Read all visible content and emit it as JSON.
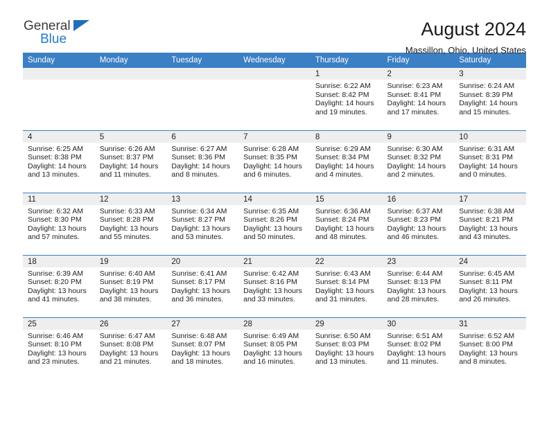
{
  "brand": {
    "name_part1": "General",
    "name_part2": "Blue",
    "triangle_color": "#1f6fb8",
    "blue_color": "#2079c7"
  },
  "header": {
    "title": "August 2024",
    "subtitle": "Massillon, Ohio, United States"
  },
  "theme": {
    "header_blue": "#3b7fc4",
    "daynum_gray": "#eeeeee"
  },
  "calendar": {
    "weekday_headers": [
      "Sunday",
      "Monday",
      "Tuesday",
      "Wednesday",
      "Thursday",
      "Friday",
      "Saturday"
    ],
    "labels": {
      "sunrise": "Sunrise:",
      "sunset": "Sunset:",
      "daylight": "Daylight:"
    },
    "weeks": [
      [
        {
          "day": "",
          "empty": true
        },
        {
          "day": "",
          "empty": true
        },
        {
          "day": "",
          "empty": true
        },
        {
          "day": "",
          "empty": true
        },
        {
          "day": "1",
          "sunrise": "Sunrise: 6:22 AM",
          "sunset": "Sunset: 8:42 PM",
          "daylight": "Daylight: 14 hours and 19 minutes."
        },
        {
          "day": "2",
          "sunrise": "Sunrise: 6:23 AM",
          "sunset": "Sunset: 8:41 PM",
          "daylight": "Daylight: 14 hours and 17 minutes."
        },
        {
          "day": "3",
          "sunrise": "Sunrise: 6:24 AM",
          "sunset": "Sunset: 8:39 PM",
          "daylight": "Daylight: 14 hours and 15 minutes."
        }
      ],
      [
        {
          "day": "4",
          "sunrise": "Sunrise: 6:25 AM",
          "sunset": "Sunset: 8:38 PM",
          "daylight": "Daylight: 14 hours and 13 minutes."
        },
        {
          "day": "5",
          "sunrise": "Sunrise: 6:26 AM",
          "sunset": "Sunset: 8:37 PM",
          "daylight": "Daylight: 14 hours and 11 minutes."
        },
        {
          "day": "6",
          "sunrise": "Sunrise: 6:27 AM",
          "sunset": "Sunset: 8:36 PM",
          "daylight": "Daylight: 14 hours and 8 minutes."
        },
        {
          "day": "7",
          "sunrise": "Sunrise: 6:28 AM",
          "sunset": "Sunset: 8:35 PM",
          "daylight": "Daylight: 14 hours and 6 minutes."
        },
        {
          "day": "8",
          "sunrise": "Sunrise: 6:29 AM",
          "sunset": "Sunset: 8:34 PM",
          "daylight": "Daylight: 14 hours and 4 minutes."
        },
        {
          "day": "9",
          "sunrise": "Sunrise: 6:30 AM",
          "sunset": "Sunset: 8:32 PM",
          "daylight": "Daylight: 14 hours and 2 minutes."
        },
        {
          "day": "10",
          "sunrise": "Sunrise: 6:31 AM",
          "sunset": "Sunset: 8:31 PM",
          "daylight": "Daylight: 14 hours and 0 minutes."
        }
      ],
      [
        {
          "day": "11",
          "sunrise": "Sunrise: 6:32 AM",
          "sunset": "Sunset: 8:30 PM",
          "daylight": "Daylight: 13 hours and 57 minutes."
        },
        {
          "day": "12",
          "sunrise": "Sunrise: 6:33 AM",
          "sunset": "Sunset: 8:28 PM",
          "daylight": "Daylight: 13 hours and 55 minutes."
        },
        {
          "day": "13",
          "sunrise": "Sunrise: 6:34 AM",
          "sunset": "Sunset: 8:27 PM",
          "daylight": "Daylight: 13 hours and 53 minutes."
        },
        {
          "day": "14",
          "sunrise": "Sunrise: 6:35 AM",
          "sunset": "Sunset: 8:26 PM",
          "daylight": "Daylight: 13 hours and 50 minutes."
        },
        {
          "day": "15",
          "sunrise": "Sunrise: 6:36 AM",
          "sunset": "Sunset: 8:24 PM",
          "daylight": "Daylight: 13 hours and 48 minutes."
        },
        {
          "day": "16",
          "sunrise": "Sunrise: 6:37 AM",
          "sunset": "Sunset: 8:23 PM",
          "daylight": "Daylight: 13 hours and 46 minutes."
        },
        {
          "day": "17",
          "sunrise": "Sunrise: 6:38 AM",
          "sunset": "Sunset: 8:21 PM",
          "daylight": "Daylight: 13 hours and 43 minutes."
        }
      ],
      [
        {
          "day": "18",
          "sunrise": "Sunrise: 6:39 AM",
          "sunset": "Sunset: 8:20 PM",
          "daylight": "Daylight: 13 hours and 41 minutes."
        },
        {
          "day": "19",
          "sunrise": "Sunrise: 6:40 AM",
          "sunset": "Sunset: 8:19 PM",
          "daylight": "Daylight: 13 hours and 38 minutes."
        },
        {
          "day": "20",
          "sunrise": "Sunrise: 6:41 AM",
          "sunset": "Sunset: 8:17 PM",
          "daylight": "Daylight: 13 hours and 36 minutes."
        },
        {
          "day": "21",
          "sunrise": "Sunrise: 6:42 AM",
          "sunset": "Sunset: 8:16 PM",
          "daylight": "Daylight: 13 hours and 33 minutes."
        },
        {
          "day": "22",
          "sunrise": "Sunrise: 6:43 AM",
          "sunset": "Sunset: 8:14 PM",
          "daylight": "Daylight: 13 hours and 31 minutes."
        },
        {
          "day": "23",
          "sunrise": "Sunrise: 6:44 AM",
          "sunset": "Sunset: 8:13 PM",
          "daylight": "Daylight: 13 hours and 28 minutes."
        },
        {
          "day": "24",
          "sunrise": "Sunrise: 6:45 AM",
          "sunset": "Sunset: 8:11 PM",
          "daylight": "Daylight: 13 hours and 26 minutes."
        }
      ],
      [
        {
          "day": "25",
          "sunrise": "Sunrise: 6:46 AM",
          "sunset": "Sunset: 8:10 PM",
          "daylight": "Daylight: 13 hours and 23 minutes."
        },
        {
          "day": "26",
          "sunrise": "Sunrise: 6:47 AM",
          "sunset": "Sunset: 8:08 PM",
          "daylight": "Daylight: 13 hours and 21 minutes."
        },
        {
          "day": "27",
          "sunrise": "Sunrise: 6:48 AM",
          "sunset": "Sunset: 8:07 PM",
          "daylight": "Daylight: 13 hours and 18 minutes."
        },
        {
          "day": "28",
          "sunrise": "Sunrise: 6:49 AM",
          "sunset": "Sunset: 8:05 PM",
          "daylight": "Daylight: 13 hours and 16 minutes."
        },
        {
          "day": "29",
          "sunrise": "Sunrise: 6:50 AM",
          "sunset": "Sunset: 8:03 PM",
          "daylight": "Daylight: 13 hours and 13 minutes."
        },
        {
          "day": "30",
          "sunrise": "Sunrise: 6:51 AM",
          "sunset": "Sunset: 8:02 PM",
          "daylight": "Daylight: 13 hours and 11 minutes."
        },
        {
          "day": "31",
          "sunrise": "Sunrise: 6:52 AM",
          "sunset": "Sunset: 8:00 PM",
          "daylight": "Daylight: 13 hours and 8 minutes."
        }
      ]
    ]
  }
}
